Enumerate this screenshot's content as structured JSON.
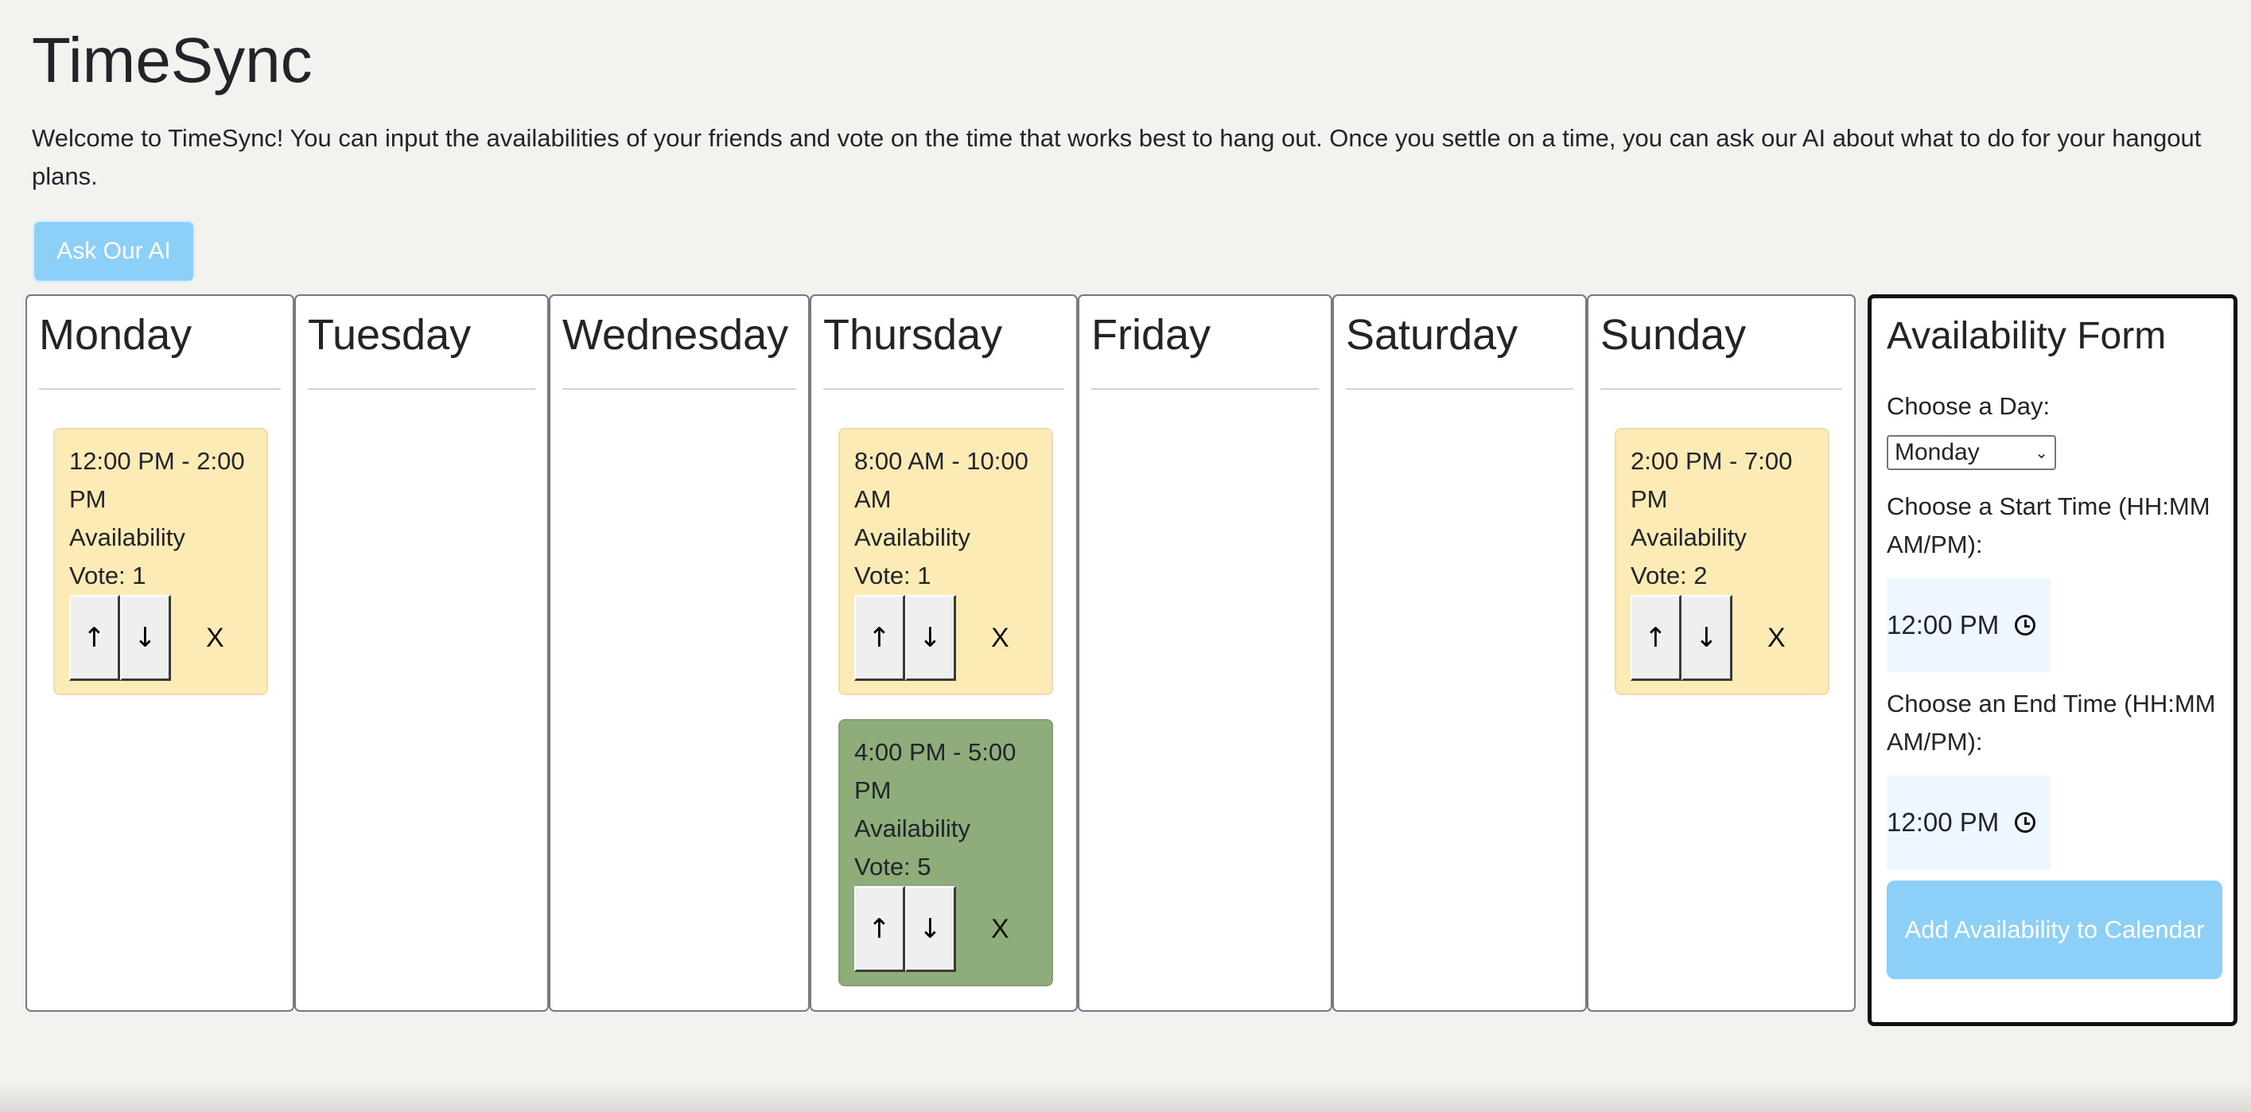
{
  "header": {
    "title": "TimeSync",
    "intro": "Welcome to TimeSync! You can input the availabilities of your friends and vote on the time that works best to hang out. Once you settle on a time, you can ask our AI about what to do for your hangout plans.",
    "ask_ai_label": "Ask Our AI"
  },
  "days": [
    {
      "name": "Monday",
      "slots": [
        {
          "time": "12:00 PM - 2:00 PM",
          "label": "Availability",
          "vote": "Vote: 1",
          "color": "#fdebb5"
        }
      ]
    },
    {
      "name": "Tuesday",
      "slots": []
    },
    {
      "name": "Wednesday",
      "slots": []
    },
    {
      "name": "Thursday",
      "slots": [
        {
          "time": "8:00 AM - 10:00 AM",
          "label": "Availability",
          "vote": "Vote: 1",
          "color": "#fdebb5"
        },
        {
          "time": "4:00 PM - 5:00 PM",
          "label": "Availability",
          "vote": "Vote: 5",
          "color": "#8fad7a"
        }
      ]
    },
    {
      "name": "Friday",
      "slots": []
    },
    {
      "name": "Saturday",
      "slots": []
    },
    {
      "name": "Sunday",
      "slots": [
        {
          "time": "2:00 PM - 7:00 PM",
          "label": "Availability",
          "vote": "Vote: 2",
          "color": "#fdebb5"
        }
      ]
    }
  ],
  "vote_controls": {
    "up": "↑",
    "down": "↓",
    "remove": "X"
  },
  "form": {
    "title": "Availability Form",
    "day_label": "Choose a Day:",
    "day_value": "Monday",
    "start_label": "Choose a Start Time (HH:MM AM/PM):",
    "start_value": "12:00 PM",
    "end_label": "Choose an End Time (HH:MM AM/PM):",
    "end_value": "12:00 PM",
    "submit_label": "Add Availability to Calendar"
  },
  "colors": {
    "accent": "#8ccff7",
    "slot_default": "#fdebb5",
    "slot_top_voted": "#8fad7a",
    "background": "#f3f2ef"
  },
  "icons": {
    "up": "arrow-up-icon",
    "down": "arrow-down-icon",
    "select": "chevron-down-icon",
    "time": "clock-icon"
  }
}
